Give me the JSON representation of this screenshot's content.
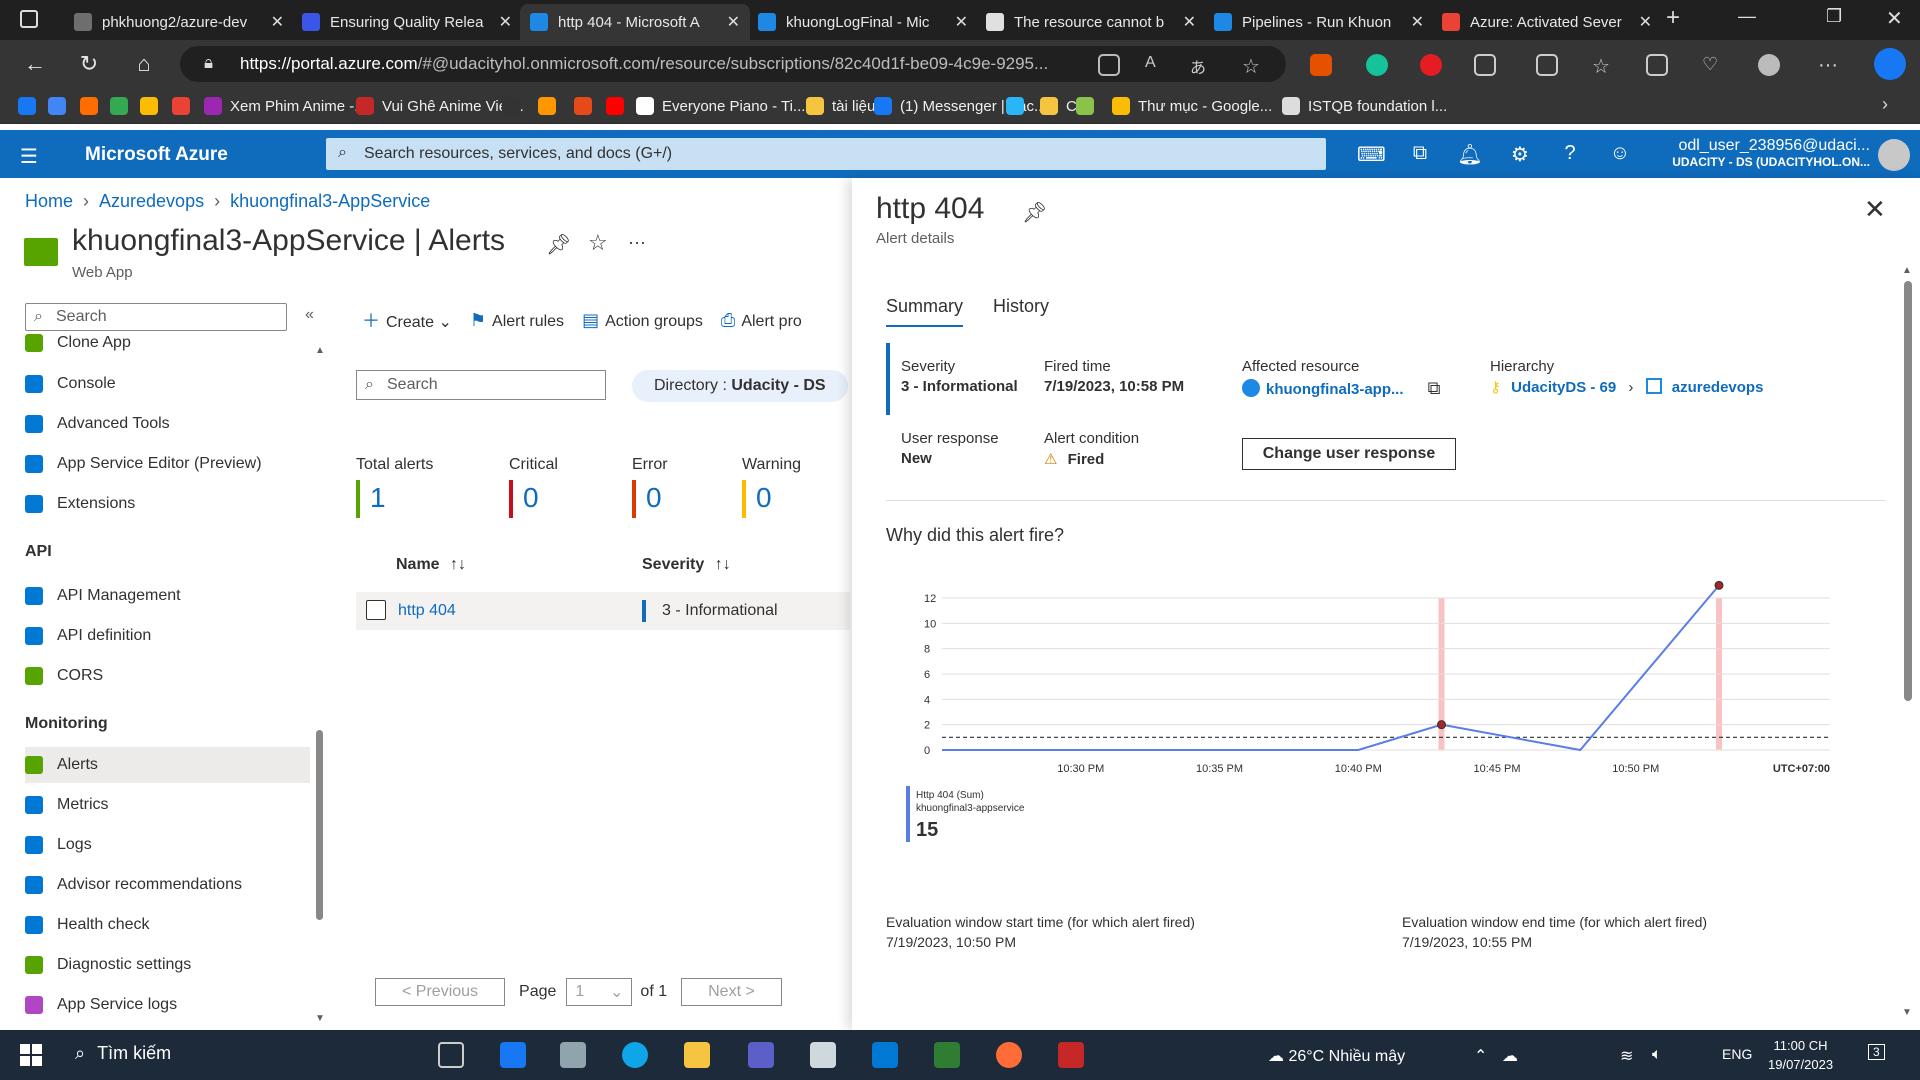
{
  "browser": {
    "tabs": [
      {
        "title": "phkhuong2/azure-dev",
        "color": "#6e6e6e"
      },
      {
        "title": "Ensuring Quality Relea",
        "color": "#3b55e6"
      },
      {
        "title": "http 404 - Microsoft A",
        "color": "#1e88e5",
        "active": true
      },
      {
        "title": "khuongLogFinal - Mic",
        "color": "#1e88e5"
      },
      {
        "title": "The resource cannot b",
        "color": "#e0e0e0"
      },
      {
        "title": "Pipelines - Run Khuon",
        "color": "#1e88e5"
      },
      {
        "title": "Azure: Activated Sever",
        "color": "#ea4335"
      }
    ],
    "url_host": "https://portal.azure.com",
    "url_rest": "/#@udacityhol.onmicrosoft.com/resource/subscriptions/82c40d1f-be09-4c9e-9295...",
    "bookmarks": [
      {
        "label": "",
        "color": "#1877f2"
      },
      {
        "label": "",
        "color": "#4285f4"
      },
      {
        "label": "",
        "color": "#ff6d00"
      },
      {
        "label": "",
        "color": "#34a853"
      },
      {
        "label": "",
        "color": "#fbbc04"
      },
      {
        "label": "",
        "color": "#ea4335"
      },
      {
        "label": "Xem Phim Anime -...",
        "color": "#9c27b0"
      },
      {
        "label": "Vui Ghê Anime Viet...",
        "color": "#c62828"
      },
      {
        "label": "",
        "color": "#333"
      },
      {
        "label": "",
        "color": "#ff9800"
      },
      {
        "label": "",
        "color": "#e64a19"
      },
      {
        "label": "",
        "color": "#ff0000"
      },
      {
        "label": "Everyone Piano - Ti...",
        "color": "#ffffff"
      },
      {
        "label": "tài liệu",
        "color": "#f5c542"
      },
      {
        "label": "(1) Messenger | Fac...",
        "color": "#1877f2"
      },
      {
        "label": "",
        "color": "#29b6f6"
      },
      {
        "label": "CV",
        "color": "#f5c542"
      },
      {
        "label": "",
        "color": "#8bc34a"
      },
      {
        "label": "Thư mục - Google...",
        "color": "#fbbc04"
      },
      {
        "label": "ISTQB foundation l...",
        "color": "#dddddd"
      }
    ]
  },
  "azure": {
    "brand": "Microsoft Azure",
    "search_placeholder": "Search resources, services, and docs (G+/)",
    "account_user": "odl_user_238956@udaci...",
    "account_dir": "UDACITY - DS (UDACITYHOL.ON..."
  },
  "breadcrumb": [
    "Home",
    "Azuredevops",
    "khuongfinal3-AppService"
  ],
  "page": {
    "title": "khuongfinal3-AppService | Alerts",
    "subtitle": "Web App",
    "more": "···"
  },
  "menu": {
    "search_placeholder": "Search",
    "items_top": [
      {
        "label": "Clone App",
        "color": "#57a300"
      },
      {
        "label": "Console",
        "color": "#0078d4"
      },
      {
        "label": "Advanced Tools",
        "color": "#0078d4"
      },
      {
        "label": "App Service Editor (Preview)",
        "color": "#0078d4"
      },
      {
        "label": "Extensions",
        "color": "#0078d4"
      }
    ],
    "api_header": "API",
    "items_api": [
      {
        "label": "API Management",
        "color": "#0078d4"
      },
      {
        "label": "API definition",
        "color": "#0078d4"
      },
      {
        "label": "CORS",
        "color": "#57a300"
      }
    ],
    "monitoring_header": "Monitoring",
    "items_mon": [
      {
        "label": "Alerts",
        "color": "#57a300",
        "selected": true
      },
      {
        "label": "Metrics",
        "color": "#0078d4"
      },
      {
        "label": "Logs",
        "color": "#0078d4"
      },
      {
        "label": "Advisor recommendations",
        "color": "#0078d4"
      },
      {
        "label": "Health check",
        "color": "#0078d4"
      },
      {
        "label": "Diagnostic settings",
        "color": "#57a300"
      },
      {
        "label": "App Service logs",
        "color": "#b146c2"
      }
    ]
  },
  "toolbar": {
    "create": "Create",
    "alert_rules": "Alert rules",
    "action_groups": "Action groups",
    "alert_pro": "Alert pro"
  },
  "filters": {
    "search_placeholder": "Search",
    "directory_label": "Directory : ",
    "directory_value": "Udacity - DS"
  },
  "stats": [
    {
      "label": "Total alerts",
      "value": "1",
      "color": "#57a300"
    },
    {
      "label": "Critical",
      "value": "0",
      "color": "#c50f1f"
    },
    {
      "label": "Error",
      "value": "0",
      "color": "#da3b01"
    },
    {
      "label": "Warning",
      "value": "0",
      "color": "#ffb900"
    }
  ],
  "table": {
    "col_name": "Name",
    "col_severity": "Severity",
    "rows": [
      {
        "name": "http 404",
        "severity": "3 - Informational"
      }
    ]
  },
  "pager": {
    "prev": "< Previous",
    "page": "Page",
    "page_value": "1",
    "of": "of 1",
    "next": "Next >"
  },
  "blade": {
    "title": "http 404",
    "subtitle": "Alert details",
    "tab_summary": "Summary",
    "tab_history": "History",
    "severity_label": "Severity",
    "severity_value": "3 - Informational",
    "fired_label": "Fired time",
    "fired_value": "7/19/2023, 10:58 PM",
    "affected_label": "Affected resource",
    "affected_value": "khuongfinal3-app...",
    "hierarchy_label": "Hierarchy",
    "hierarchy_1": "UdacityDS - 69",
    "hierarchy_2": "azuredevops",
    "response_label": "User response",
    "response_value": "New",
    "condition_label": "Alert condition",
    "condition_value": "Fired",
    "change_btn": "Change user response",
    "why": "Why did this alert fire?",
    "eval_start_label": "Evaluation window start time (for which alert fired)",
    "eval_start_value": "7/19/2023, 10:50 PM",
    "eval_end_label": "Evaluation window end time (for which alert fired)",
    "eval_end_value": "7/19/2023, 10:55 PM"
  },
  "chart_data": {
    "type": "line",
    "x": [
      "10:25 PM",
      "10:30 PM",
      "10:35 PM",
      "10:40 PM",
      "10:43 PM",
      "10:48 PM",
      "10:53 PM"
    ],
    "xticks": [
      "10:30 PM",
      "10:35 PM",
      "10:40 PM",
      "10:45 PM",
      "10:50 PM"
    ],
    "timezone": "UTC+07:00",
    "yticks": [
      0,
      2,
      4,
      6,
      8,
      10,
      12
    ],
    "ylim": [
      0,
      12
    ],
    "threshold": 1,
    "series": [
      {
        "name": "Http 404 (Sum)",
        "resource": "khuongfinal3-appservice",
        "values": [
          0,
          0,
          0,
          0,
          2,
          0,
          13
        ],
        "color": "#5b7de8"
      }
    ],
    "total": "15",
    "fired_markers": [
      "10:43 PM",
      "10:53 PM"
    ]
  },
  "taskbar": {
    "search": "Tìm kiếm",
    "weather": "26°C  Nhiều mây",
    "lang": "ENG",
    "time": "11:00 CH",
    "date": "19/07/2023",
    "notif": "3"
  }
}
